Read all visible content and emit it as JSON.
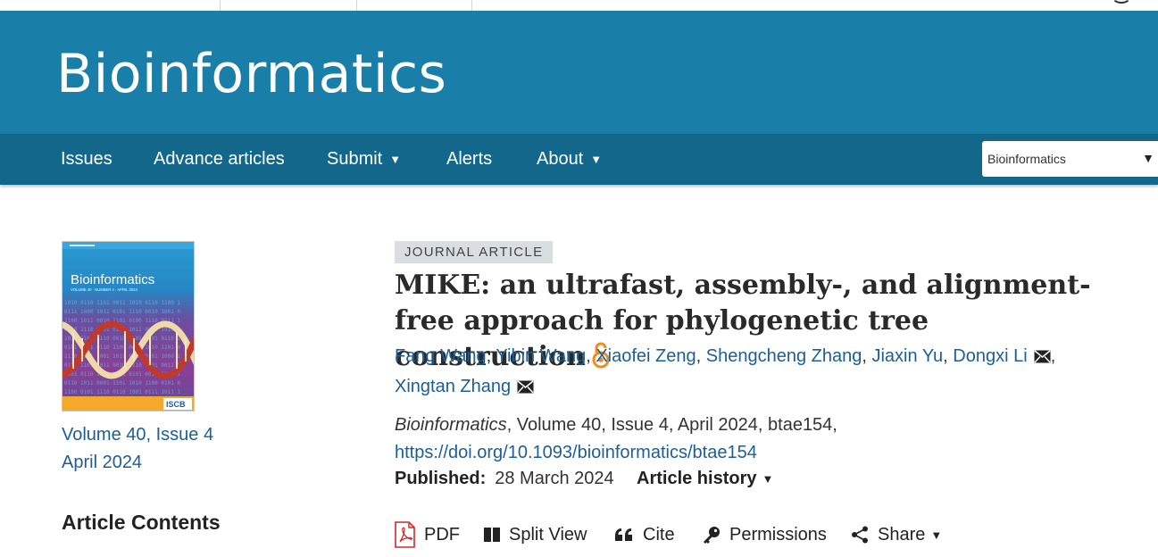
{
  "header": {
    "journal_name": "Bioinformatics"
  },
  "nav": {
    "items": [
      {
        "label": "Issues",
        "has_dropdown": false
      },
      {
        "label": "Advance articles",
        "has_dropdown": false
      },
      {
        "label": "Submit",
        "has_dropdown": true
      },
      {
        "label": "Alerts",
        "has_dropdown": false
      },
      {
        "label": "About",
        "has_dropdown": true
      }
    ],
    "journal_select": {
      "selected": "Bioinformatics"
    },
    "caret": "▼"
  },
  "sidebar": {
    "cover": {
      "journal": "Bioinformatics",
      "volume_line": "VOLUME 40 · NUMBER 4 · APRIL 2024",
      "publisher_badge": "ISCB"
    },
    "volume_issue": "Volume 40, Issue 4",
    "issue_date": "April 2024",
    "contents_heading": "Article Contents"
  },
  "article": {
    "type_badge": "JOURNAL ARTICLE",
    "title": "MIKE: an ultrafast, assembly-, and alignment-free approach for phylogenetic tree construction",
    "open_access_icon": "open-access-icon",
    "authors": [
      {
        "name": "Fang Wang",
        "corresponding": false
      },
      {
        "name": "Yibin Wang",
        "corresponding": false
      },
      {
        "name": "Xiaofei Zeng",
        "corresponding": false
      },
      {
        "name": "Shengcheng Zhang",
        "corresponding": false
      },
      {
        "name": "Jiaxin Yu",
        "corresponding": false
      },
      {
        "name": "Dongxi Li",
        "corresponding": true
      },
      {
        "name": "Xingtan Zhang",
        "corresponding": true
      }
    ],
    "citation": {
      "journal": "Bioinformatics",
      "details": ", Volume 40, Issue 4, April 2024, btae154,",
      "doi": "https://doi.org/10.1093/bioinformatics/btae154"
    },
    "published_label": "Published:",
    "published_date": "28 March 2024",
    "history_label": "Article history"
  },
  "tools": {
    "pdf": "PDF",
    "split_view": "Split View",
    "cite": "Cite",
    "permissions": "Permissions",
    "share": "Share"
  },
  "colors": {
    "banner": "#197fa8",
    "navbar": "#13678a",
    "link": "#1d5e94",
    "open_access": "#f28b1f",
    "pdf_red": "#d3282b"
  }
}
